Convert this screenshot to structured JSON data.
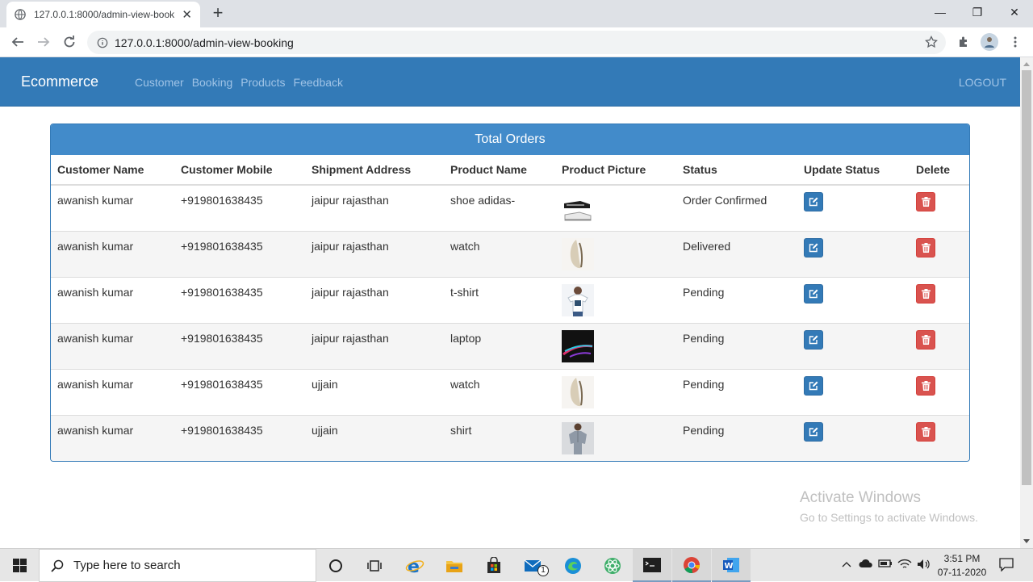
{
  "browser": {
    "tab_title": "127.0.0.1:8000/admin-view-book",
    "tab_close": "✕",
    "new_tab": "+",
    "url": "127.0.0.1:8000/admin-view-booking",
    "window_controls": [
      "—",
      "❐",
      "✕"
    ]
  },
  "navbar": {
    "brand": "Ecommerce",
    "links": [
      "Customer",
      "Booking",
      "Products",
      "Feedback"
    ],
    "logout": "LOGOUT"
  },
  "panel": {
    "heading": "Total Orders",
    "columns": [
      "Customer Name",
      "Customer Mobile",
      "Shipment Address",
      "Product Name",
      "Product Picture",
      "Status",
      "Update Status",
      "Delete"
    ],
    "rows": [
      {
        "name": "awanish kumar",
        "mobile": "+919801638435",
        "address": "jaipur rajasthan",
        "product": "shoe adidas-",
        "picture": "shoe-thumbnail",
        "status": "Order Confirmed"
      },
      {
        "name": "awanish kumar",
        "mobile": "+919801638435",
        "address": "jaipur rajasthan",
        "product": "watch",
        "picture": "watch-thumbnail",
        "status": "Delivered"
      },
      {
        "name": "awanish kumar",
        "mobile": "+919801638435",
        "address": "jaipur rajasthan",
        "product": "t-shirt",
        "picture": "tshirt-thumbnail",
        "status": "Pending"
      },
      {
        "name": "awanish kumar",
        "mobile": "+919801638435",
        "address": "jaipur rajasthan",
        "product": "laptop",
        "picture": "laptop-thumbnail",
        "status": "Pending"
      },
      {
        "name": "awanish kumar",
        "mobile": "+919801638435",
        "address": "ujjain",
        "product": "watch",
        "picture": "watch-thumbnail",
        "status": "Pending"
      },
      {
        "name": "awanish kumar",
        "mobile": "+919801638435",
        "address": "ujjain",
        "product": "shirt",
        "picture": "shirt-thumbnail",
        "status": "Pending"
      }
    ]
  },
  "watermark": {
    "line1": "Activate Windows",
    "line2": "Go to Settings to activate Windows."
  },
  "taskbar": {
    "search_placeholder": "Type here to search",
    "mail_badge": "1",
    "time": "3:51 PM",
    "date": "07-11-2020"
  },
  "colors": {
    "navbar": "#337ab7",
    "panel_heading": "#428bca",
    "edit_button": "#337ab7",
    "delete_button": "#d9534f"
  }
}
